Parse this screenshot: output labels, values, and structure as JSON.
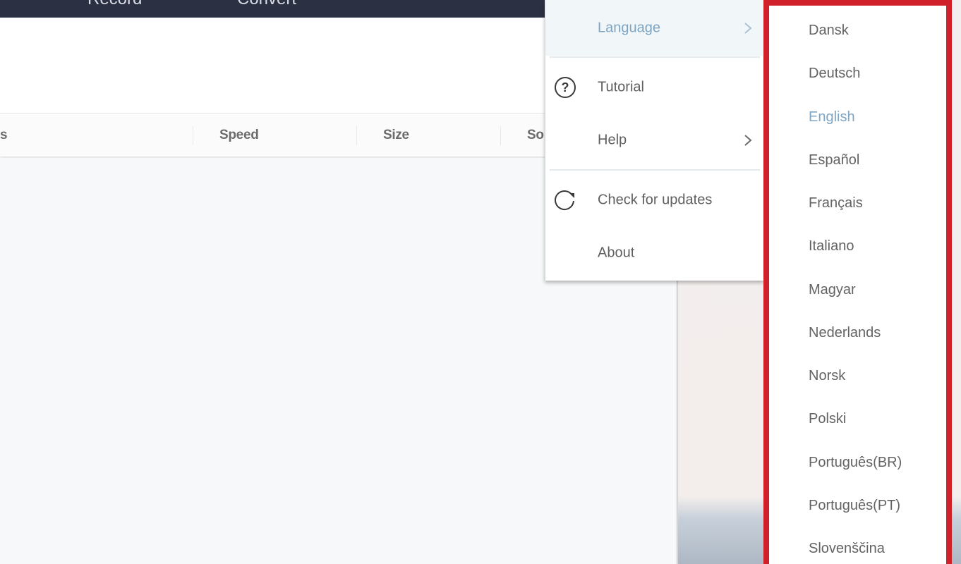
{
  "topnav": {
    "tabs": [
      {
        "label": "Record"
      },
      {
        "label": "Convert"
      }
    ]
  },
  "table": {
    "columns": [
      {
        "label": "s"
      },
      {
        "label": "Speed"
      },
      {
        "label": "Size"
      },
      {
        "label": "So"
      }
    ]
  },
  "menu": {
    "items": [
      {
        "label": "Language",
        "icon": "none",
        "has_submenu": true,
        "highlighted": true
      },
      {
        "label": "Tutorial",
        "icon": "question-circle-icon",
        "has_submenu": false
      },
      {
        "label": "Help",
        "icon": "none",
        "has_submenu": true
      },
      {
        "label": "Check for updates",
        "icon": "refresh-icon",
        "has_submenu": false
      },
      {
        "label": "About",
        "icon": "none",
        "has_submenu": false
      }
    ]
  },
  "language_submenu": {
    "selected": "English",
    "items": [
      {
        "label": "Dansk"
      },
      {
        "label": "Deutsch"
      },
      {
        "label": "English"
      },
      {
        "label": "Español"
      },
      {
        "label": "Français"
      },
      {
        "label": "Italiano"
      },
      {
        "label": "Magyar"
      },
      {
        "label": "Nederlands"
      },
      {
        "label": "Norsk"
      },
      {
        "label": "Polski"
      },
      {
        "label": "Português(BR)"
      },
      {
        "label": "Português(PT)"
      },
      {
        "label": "Slovenščina"
      }
    ]
  },
  "colors": {
    "nav_background": "#2b3043",
    "accent_blue": "#7fa5c4",
    "highlight_frame_red": "#d0202a",
    "menu_text": "#5f5f5f"
  }
}
